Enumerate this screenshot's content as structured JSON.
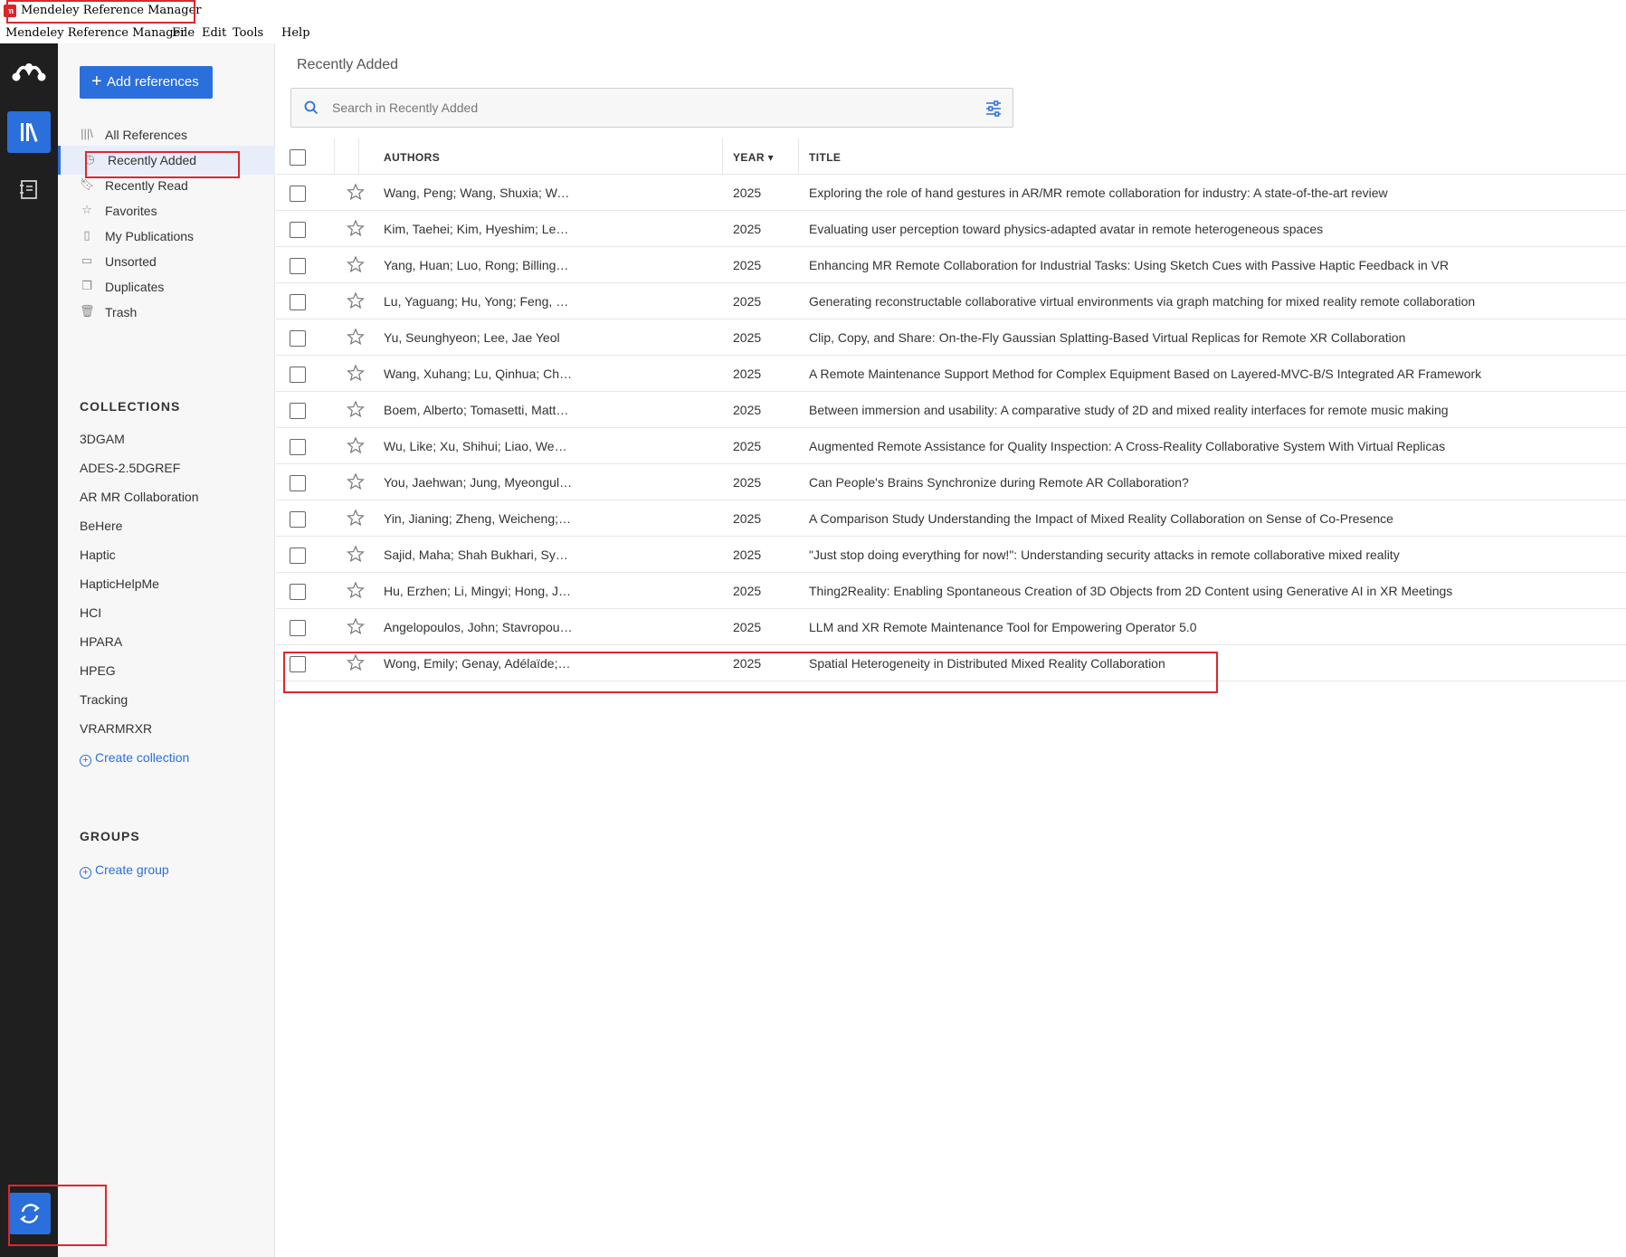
{
  "window": {
    "title": "Mendeley Reference Manager"
  },
  "menu": [
    "Mendeley Reference Manager",
    "File",
    "Edit",
    "Tools",
    "Help"
  ],
  "sidebar": {
    "add_button": "Add references",
    "nav": [
      {
        "label": "All References",
        "icon": "library-icon"
      },
      {
        "label": "Recently Added",
        "icon": "clock-icon"
      },
      {
        "label": "Recently Read",
        "icon": "bookmark-icon"
      },
      {
        "label": "Favorites",
        "icon": "star-icon"
      },
      {
        "label": "My Publications",
        "icon": "publication-icon"
      },
      {
        "label": "Unsorted",
        "icon": "inbox-icon"
      },
      {
        "label": "Duplicates",
        "icon": "duplicates-icon"
      },
      {
        "label": "Trash",
        "icon": "trash-icon"
      }
    ],
    "collections_title": "COLLECTIONS",
    "collections": [
      "3DGAM",
      "ADES-2.5DGREF",
      "AR MR Collaboration",
      "BeHere",
      "Haptic",
      "HapticHelpMe",
      "HCI",
      "HPARA",
      "HPEG",
      "Tracking",
      "VRARMRXR"
    ],
    "create_collection": "Create collection",
    "groups_title": "GROUPS",
    "create_group": "Create group"
  },
  "main": {
    "title": "Recently Added",
    "search_placeholder": "Search in Recently Added",
    "columns": {
      "authors": "AUTHORS",
      "year": "YEAR ▾",
      "title": "TITLE"
    },
    "rows": [
      {
        "authors": "Wang, Peng; Wang, Shuxia; Wang, Yue; Billinghurst, Mark; Zhang, Xiaoliang",
        "year": "2025",
        "title": "Exploring the role of hand gestures in AR/MR remote collaboration for industry: A state-of-the-art review"
      },
      {
        "authors": "Kim, Taehei; Kim, Hyeshim; Lee, Jeongmi; Lee, Sung-Hee",
        "year": "2025",
        "title": "Evaluating user perception toward physics-adapted avatar in remote heterogeneous spaces"
      },
      {
        "authors": "Yang, Huan; Luo, Rong; Billinghurst, Mark; Wang, Yue; Wang, Peng",
        "year": "2025",
        "title": "Enhancing MR Remote Collaboration for Industrial Tasks: Using Sketch Cues with Passive Haptic Feedback in VR"
      },
      {
        "authors": "Lu, Yaguang; Hu, Yong; Feng, Huiyan; Duan, Pengshuai; Shen, Xukun",
        "year": "2025",
        "title": "Generating reconstructable collaborative virtual environments via graph matching for mixed reality remote collaboration"
      },
      {
        "authors": "Yu, Seunghyeon; Lee, Jae Yeol",
        "year": "2025",
        "title": "Clip, Copy, and Share: On-the-Fly Gaussian Splatting-Based Virtual Replicas for Remote XR Collaboration"
      },
      {
        "authors": "Wang, Xuhang; Lu, Qinhua; Chen, Jiayu; Zhou, Dong",
        "year": "2025",
        "title": "A Remote Maintenance Support Method for Complex Equipment Based on Layered-MVC-B/S Integrated AR Framework"
      },
      {
        "authors": "Boem, Alberto; Tomasetti, Matteo; Turchet, Luca",
        "year": "2025",
        "title": "Between immersion and usability: A comparative study of 2D and mixed reality interfaces for remote music making"
      },
      {
        "authors": "Wu, Like; Xu, Shihui; Liao, Wenjie; Fujimura, Shigeru",
        "year": "2025",
        "title": "Augmented Remote Assistance for Quality Inspection: A Cross-Reality Collaborative System With Virtual Replicas"
      },
      {
        "authors": "You, Jaehwan; Jung, Myeongul; Kim, Kwanguk",
        "year": "2025",
        "title": "Can People's Brains Synchronize during Remote AR Collaboration?"
      },
      {
        "authors": "Yin, Jianing; Zheng, Weicheng; Wang, Yuntao; Tong, Xin; Shi, Yuanchun",
        "year": "2025",
        "title": "A Comparison Study Understanding the Impact of Mixed Reality Collaboration on Sense of Co-Presence"
      },
      {
        "authors": "Sajid, Maha; Shah Bukhari, Syed Ibrahim Mustafa; Ji, Bo; Brown, Brendan David",
        "year": "2025",
        "title": "\"Just stop doing everything for now!\": Understanding security attacks in remote collaborative mixed reality"
      },
      {
        "authors": "Hu, Erzhen; Li, Mingyi; Hong, Jungtaek; Qian, Xun; Olwal, Alex",
        "year": "2025",
        "title": "Thing2Reality: Enabling Spontaneous Creation of 3D Objects from 2D Content using Generative AI in XR Meetings"
      },
      {
        "authors": "Angelopoulos, John; Stavropoulos, Panagiotis; Manettas, Christos",
        "year": "2025",
        "title": "LLM and XR Remote Maintenance Tool for Empowering Operator 5.0"
      },
      {
        "authors": "Wong, Emily; Genay, Adélaïde; Grønbæk, Jens Emil Sloth; Velloso, Eduardo",
        "year": "2025",
        "title": "Spatial Heterogeneity in Distributed Mixed Reality Collaboration"
      }
    ]
  },
  "colors": {
    "accent": "#2a6fdb",
    "rail": "#1f1f1f",
    "annotation": "#e0262e"
  }
}
